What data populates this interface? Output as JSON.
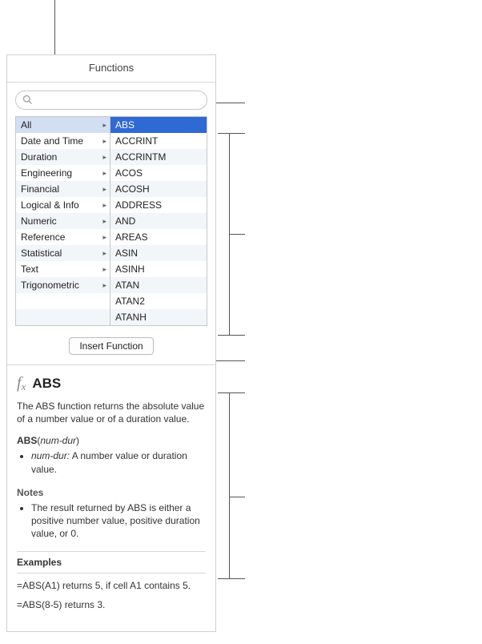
{
  "header": {
    "title": "Functions"
  },
  "search": {
    "placeholder": ""
  },
  "categories": [
    "All",
    "Date and Time",
    "Duration",
    "Engineering",
    "Financial",
    "Logical & Info",
    "Numeric",
    "Reference",
    "Statistical",
    "Text",
    "Trigonometric"
  ],
  "selected_category_index": 0,
  "functions": [
    "ABS",
    "ACCRINT",
    "ACCRINTM",
    "ACOS",
    "ACOSH",
    "ADDRESS",
    "AND",
    "AREAS",
    "ASIN",
    "ASINH",
    "ATAN",
    "ATAN2",
    "ATANH"
  ],
  "selected_function_index": 0,
  "insert": {
    "label": "Insert Function"
  },
  "help": {
    "title": "ABS",
    "description": "The ABS function returns the absolute value of a number value or of a duration value.",
    "signature_name": "ABS",
    "signature_param": "num-dur",
    "params": [
      {
        "name": "num-dur",
        "desc": "A number value or duration value."
      }
    ],
    "notes_heading": "Notes",
    "notes": [
      "The result returned by ABS is either a positive number value, positive duration value, or 0."
    ],
    "examples_heading": "Examples",
    "examples": [
      "=ABS(A1) returns 5, if cell A1 contains 5.",
      "=ABS(8-5) returns 3."
    ]
  }
}
